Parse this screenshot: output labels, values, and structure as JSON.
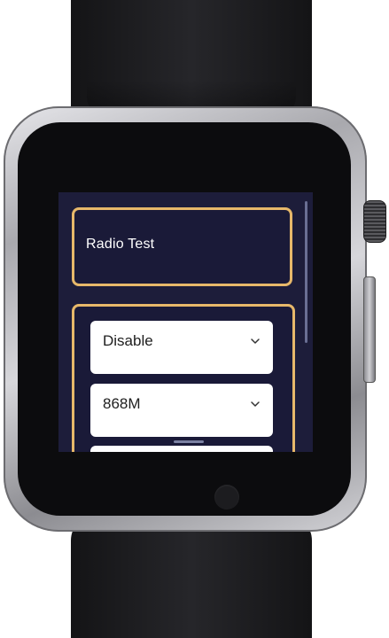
{
  "app": {
    "title": "Radio Test"
  },
  "settings": {
    "mode_select": {
      "value": "Disable"
    },
    "frequency_select": {
      "value": "868M"
    },
    "third_select": {
      "value": ""
    }
  },
  "icons": {
    "dropdown": "chevron-down-icon"
  },
  "colors": {
    "screen_background": "#1d1d3a",
    "card_border": "#e7b86a",
    "select_background": "#ffffff",
    "title_text": "#ffffff"
  }
}
